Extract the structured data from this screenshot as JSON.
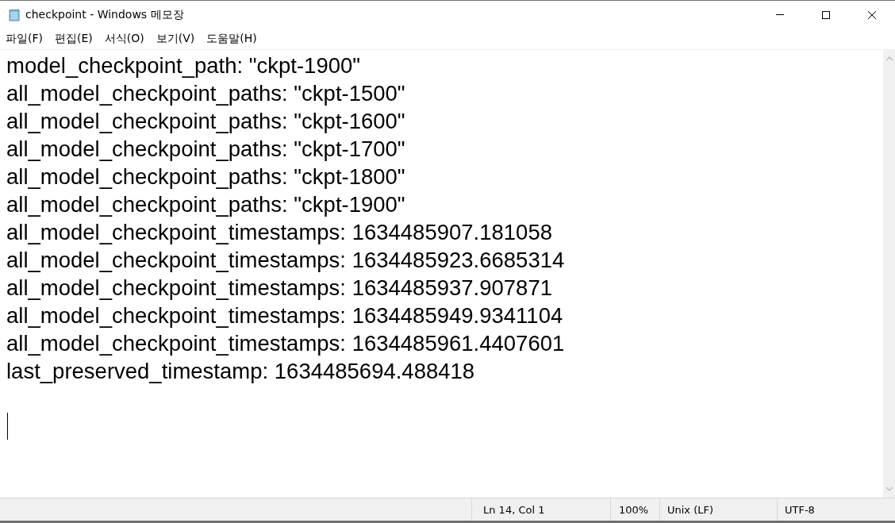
{
  "window": {
    "title": "checkpoint - Windows 메모장"
  },
  "menu": [
    {
      "label": "파일(F)"
    },
    {
      "label": "편집(E)"
    },
    {
      "label": "서식(O)"
    },
    {
      "label": "보기(V)"
    },
    {
      "label": "도움말(H)"
    }
  ],
  "editor": {
    "lines": [
      "model_checkpoint_path: \"ckpt-1900\"",
      "all_model_checkpoint_paths: \"ckpt-1500\"",
      "all_model_checkpoint_paths: \"ckpt-1600\"",
      "all_model_checkpoint_paths: \"ckpt-1700\"",
      "all_model_checkpoint_paths: \"ckpt-1800\"",
      "all_model_checkpoint_paths: \"ckpt-1900\"",
      "all_model_checkpoint_timestamps: 1634485907.181058",
      "all_model_checkpoint_timestamps: 1634485923.6685314",
      "all_model_checkpoint_timestamps: 1634485937.907871",
      "all_model_checkpoint_timestamps: 1634485949.9341104",
      "all_model_checkpoint_timestamps: 1634485961.4407601",
      "last_preserved_timestamp: 1634485694.488418"
    ]
  },
  "status_bar": {
    "position": "Ln 14, Col 1",
    "zoom": "100%",
    "line_ending": "Unix (LF)",
    "encoding": "UTF-8"
  }
}
